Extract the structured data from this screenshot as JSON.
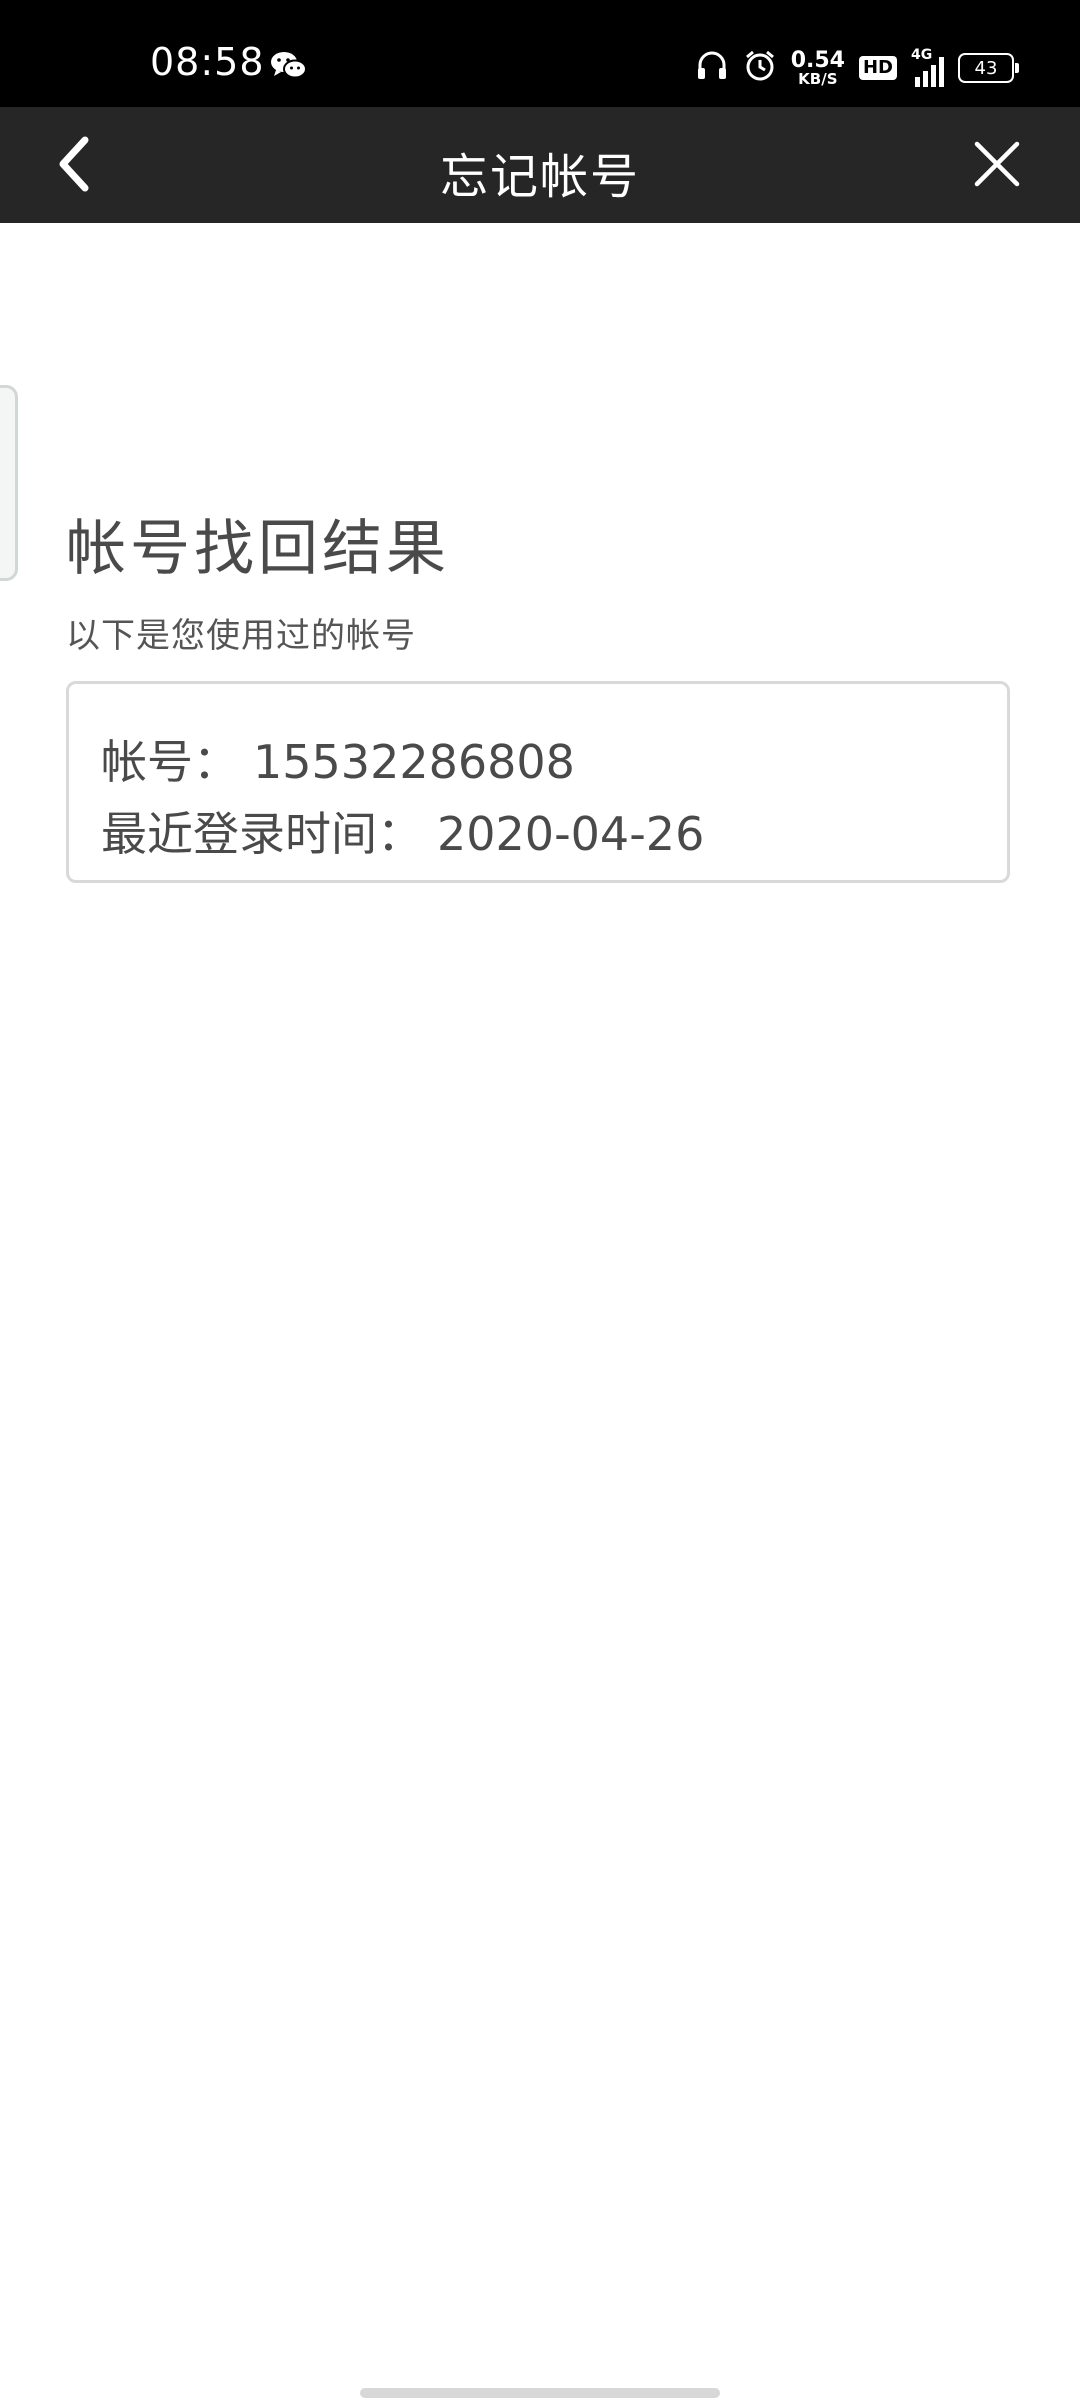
{
  "status_bar": {
    "time": "08:58",
    "net_speed_value": "0.54",
    "net_speed_unit": "KB/S",
    "hd_label": "HD",
    "network_type": "4G",
    "battery_level": "43",
    "icons": [
      "wechat-icon",
      "headset-icon",
      "alarm-icon",
      "signal-icon",
      "battery-icon"
    ]
  },
  "nav": {
    "title": "忘记帐号",
    "back_icon": "chevron-left-icon",
    "close_icon": "close-icon"
  },
  "result": {
    "title": "帐号找回结果",
    "subtitle": "以下是您使用过的帐号",
    "account_label": "帐号：",
    "account_value": "15532286808",
    "last_login_label": "最近登录时间：",
    "last_login_value": "2020-04-26"
  },
  "colors": {
    "status_bar_bg": "#000000",
    "nav_bg": "#262626",
    "text": "#4a4a4a",
    "card_border": "#d9d9d9"
  }
}
